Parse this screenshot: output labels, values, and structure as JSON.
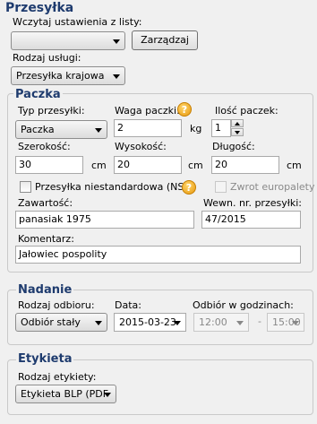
{
  "przesylka": {
    "title": "Przesyłka",
    "settings_label": "Wczytaj ustawienia z listy:",
    "settings_value": "",
    "manage_button": "Zarządzaj",
    "service_label": "Rodzaj usługi:",
    "service_value": "Przesyłka krajowa"
  },
  "paczka": {
    "title": "Paczka",
    "type_label": "Typ przesyłki:",
    "type_value": "Paczka",
    "weight_label": "Waga paczki:",
    "weight_value": "2",
    "weight_unit": "kg",
    "count_label": "Ilość paczek:",
    "count_value": "1",
    "width_label": "Szerokość:",
    "width_value": "30",
    "width_unit": "cm",
    "height_label": "Wysokość:",
    "height_value": "20",
    "height_unit": "cm",
    "length_label": "Długość:",
    "length_value": "20",
    "length_unit": "cm",
    "nst_label": "Przesyłka niestandardowa (NST)",
    "nst_checked": false,
    "europallet_label": "Zwrot europalety",
    "europallet_checked": false,
    "content_label": "Zawartość:",
    "content_value": "panasiak 1975",
    "internal_nr_label": "Wewn. nr. przesyłki:",
    "internal_nr_value": "47/2015",
    "comment_label": "Komentarz:",
    "comment_value": "Jałowiec pospolity",
    "help_glyph": "?"
  },
  "nadanie": {
    "title": "Nadanie",
    "pickup_type_label": "Rodzaj odbioru:",
    "pickup_type_value": "Odbiór stały",
    "date_label": "Data:",
    "date_value": "2015-03-23",
    "hours_label": "Odbiór w godzinach:",
    "hour_from": "12:00",
    "hour_sep": "-",
    "hour_to": "15:00"
  },
  "etykieta": {
    "title": "Etykieta",
    "label_type_label": "Rodzaj etykiety:",
    "label_type_value": "Etykieta BLP (PDF"
  },
  "colors": {
    "heading": "#1e3b6e",
    "help_icon": "#f0a31c"
  },
  "icons": {
    "help": "help-icon",
    "dropdown": "chevron-down-icon"
  }
}
